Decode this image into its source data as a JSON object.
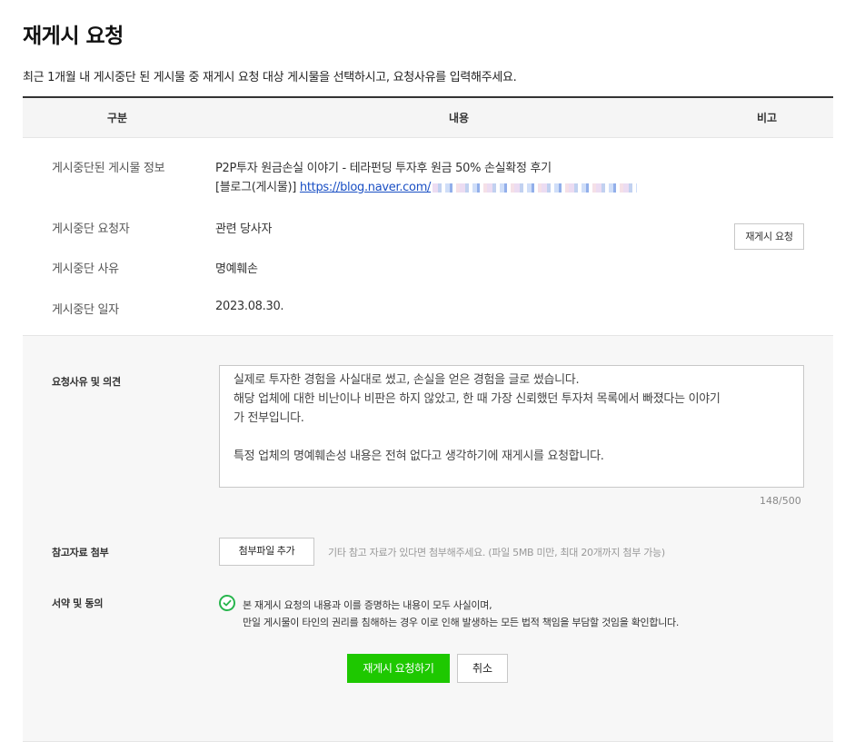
{
  "page": {
    "title": "재게시 요청",
    "description": "최근 1개월 내 게시중단 된 게시물 중 재게시 요청 대상 게시물을 선택하시고, 요청사유를 입력해주세요."
  },
  "table": {
    "headers": [
      "구분",
      "내용",
      "비고"
    ]
  },
  "info": {
    "post_label": "게시중단된 게시물 정보",
    "post_title": "P2P투자 원금손실 이야기 - 테라펀딩 투자후 원금 50% 손실확정 후기",
    "post_type": "[블로그(게시물)]",
    "post_url": "https://blog.naver.com/",
    "requester_label": "게시중단 요청자",
    "requester_value": "관련 당사자",
    "reason_label": "게시중단 사유",
    "reason_value": "명예훼손",
    "date_label": "게시중단 일자",
    "date_value": "2023.08.30.",
    "repost_button": "재게시 요청"
  },
  "form": {
    "opinion_label": "요청사유 및 의견",
    "opinion_lines": [
      "실제로 투자한 경험을 사실대로 썼고, 손실을 얻은 경험을 글로 썼습니다.",
      "해당 업체에 대한 비난이나 비판은 하지 않았고, 한 때 가장 신뢰했던 투자처 목록에서 빠졌다는 이야기",
      "가 전부입니다.",
      "",
      "특정 업체의 명예훼손성 내용은 전혀 없다고 생각하기에 재게시를 요청합니다."
    ],
    "char_count": "148/500",
    "attach_label": "참고자료 첨부",
    "attach_button": "첨부파일 추가",
    "attach_hint": "기타 참고 자료가 있다면 첨부해주세요. (파일 5MB 미만, 최대 20개까지 첨부 가능)",
    "agree_label": "서약 및 동의",
    "agree_line1": "본 재게시 요청의 내용과 이를 증명하는 내용이 모두 사실이며,",
    "agree_line2": "만일 게시물이 타인의 권리를 침해하는 경우 이로 인해 발생하는 모든 법적 책임을 부담할 것임을 확인합니다.",
    "agree_checked": true,
    "submit_button": "재게시 요청하기",
    "cancel_button": "취소"
  },
  "colors": {
    "accent_green": "#1ec800",
    "check_green": "#27b54d",
    "link_blue": "#1a4fc4"
  },
  "icons": [
    "check-circle-icon"
  ]
}
